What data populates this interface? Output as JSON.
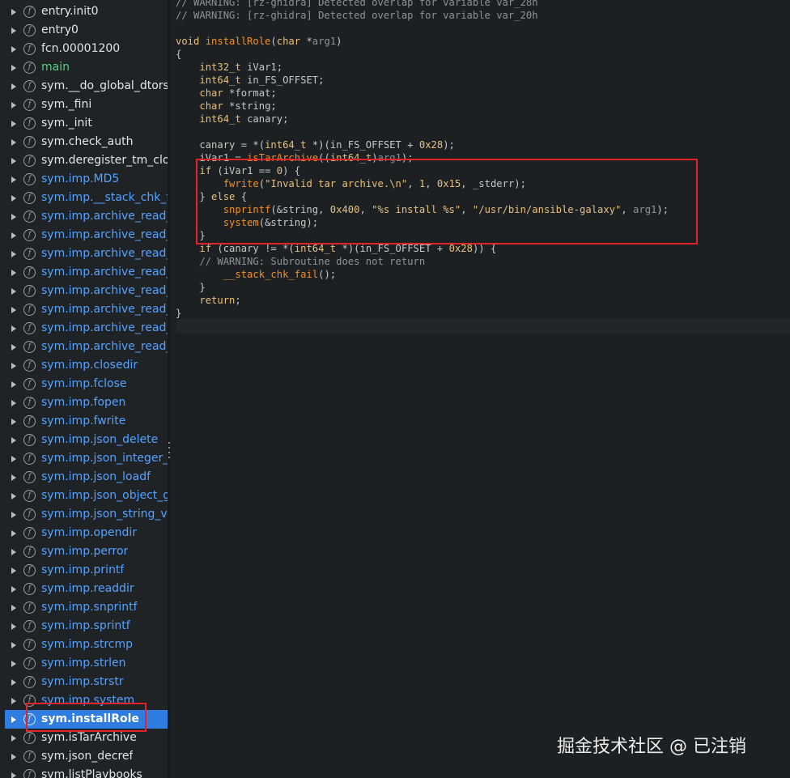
{
  "sidebar": {
    "items": [
      {
        "label": "entry.init0",
        "color": "white"
      },
      {
        "label": "entry0",
        "color": "white"
      },
      {
        "label": "fcn.00001200",
        "color": "white"
      },
      {
        "label": "main",
        "color": "green"
      },
      {
        "label": "sym.__do_global_dtors_",
        "color": "white"
      },
      {
        "label": "sym._fini",
        "color": "white"
      },
      {
        "label": "sym._init",
        "color": "white"
      },
      {
        "label": "sym.check_auth",
        "color": "white"
      },
      {
        "label": "sym.deregister_tm_clon",
        "color": "white"
      },
      {
        "label": "sym.imp.MD5",
        "color": "blue"
      },
      {
        "label": "sym.imp.__stack_chk_fa",
        "color": "blue"
      },
      {
        "label": "sym.imp.archive_read_c",
        "color": "blue"
      },
      {
        "label": "sym.imp.archive_read_c",
        "color": "blue"
      },
      {
        "label": "sym.imp.archive_read_f",
        "color": "blue"
      },
      {
        "label": "sym.imp.archive_read_n",
        "color": "blue"
      },
      {
        "label": "sym.imp.archive_read_n",
        "color": "blue"
      },
      {
        "label": "sym.imp.archive_read_o",
        "color": "blue"
      },
      {
        "label": "sym.imp.archive_read_s",
        "color": "blue"
      },
      {
        "label": "sym.imp.archive_read_s",
        "color": "blue"
      },
      {
        "label": "sym.imp.closedir",
        "color": "blue"
      },
      {
        "label": "sym.imp.fclose",
        "color": "blue"
      },
      {
        "label": "sym.imp.fopen",
        "color": "blue"
      },
      {
        "label": "sym.imp.fwrite",
        "color": "blue"
      },
      {
        "label": "sym.imp.json_delete",
        "color": "blue"
      },
      {
        "label": "sym.imp.json_integer_v",
        "color": "blue"
      },
      {
        "label": "sym.imp.json_loadf",
        "color": "blue"
      },
      {
        "label": "sym.imp.json_object_ge",
        "color": "blue"
      },
      {
        "label": "sym.imp.json_string_va",
        "color": "blue"
      },
      {
        "label": "sym.imp.opendir",
        "color": "blue"
      },
      {
        "label": "sym.imp.perror",
        "color": "blue"
      },
      {
        "label": "sym.imp.printf",
        "color": "blue"
      },
      {
        "label": "sym.imp.readdir",
        "color": "blue"
      },
      {
        "label": "sym.imp.snprintf",
        "color": "blue"
      },
      {
        "label": "sym.imp.sprintf",
        "color": "blue"
      },
      {
        "label": "sym.imp.strcmp",
        "color": "blue"
      },
      {
        "label": "sym.imp.strlen",
        "color": "blue"
      },
      {
        "label": "sym.imp.strstr",
        "color": "blue"
      },
      {
        "label": "sym.imp.system",
        "color": "blue"
      },
      {
        "label": "sym.installRole",
        "color": "selected"
      },
      {
        "label": "sym.isTarArchive",
        "color": "white"
      },
      {
        "label": "sym.json_decref",
        "color": "white"
      },
      {
        "label": "sym.listPlaybooks",
        "color": "white"
      }
    ]
  },
  "code": {
    "lines": [
      [
        [
          "cm",
          "// WARNING: [rz-ghidra] Detected overlap for variable var_28h"
        ]
      ],
      [
        [
          "cm",
          "// WARNING: [rz-ghidra] Detected overlap for variable var_20h"
        ]
      ],
      [],
      [
        [
          "kw",
          "void "
        ],
        [
          "fn",
          "installRole"
        ],
        [
          "tx",
          "("
        ],
        [
          "ty",
          "char"
        ],
        [
          "tx",
          " *"
        ],
        [
          "ar",
          "arg1"
        ],
        [
          "tx",
          ")"
        ]
      ],
      [
        [
          "tx",
          "{"
        ]
      ],
      [
        [
          "tx",
          "    "
        ],
        [
          "ty",
          "int32_t"
        ],
        [
          "tx",
          " iVar1;"
        ]
      ],
      [
        [
          "tx",
          "    "
        ],
        [
          "ty",
          "int64_t"
        ],
        [
          "tx",
          " in_FS_OFFSET;"
        ]
      ],
      [
        [
          "tx",
          "    "
        ],
        [
          "ty",
          "char"
        ],
        [
          "tx",
          " *format;"
        ]
      ],
      [
        [
          "tx",
          "    "
        ],
        [
          "ty",
          "char"
        ],
        [
          "tx",
          " *string;"
        ]
      ],
      [
        [
          "tx",
          "    "
        ],
        [
          "ty",
          "int64_t"
        ],
        [
          "tx",
          " canary;"
        ]
      ],
      [],
      [
        [
          "tx",
          "    canary = *("
        ],
        [
          "ty",
          "int64_t"
        ],
        [
          "tx",
          " *)(in_FS_OFFSET + "
        ],
        [
          "nu",
          "0x28"
        ],
        [
          "tx",
          ");"
        ]
      ],
      [
        [
          "tx",
          "    iVar1 = "
        ],
        [
          "fn",
          "isTarArchive"
        ],
        [
          "tx",
          "(("
        ],
        [
          "ty",
          "int64_t"
        ],
        [
          "tx",
          ")"
        ],
        [
          "ar",
          "arg1"
        ],
        [
          "tx",
          ");"
        ]
      ],
      [
        [
          "tx",
          "    "
        ],
        [
          "kw",
          "if"
        ],
        [
          "tx",
          " (iVar1 == "
        ],
        [
          "nu",
          "0"
        ],
        [
          "tx",
          ") {"
        ]
      ],
      [
        [
          "tx",
          "        "
        ],
        [
          "fn",
          "fwrite"
        ],
        [
          "tx",
          "("
        ],
        [
          "st",
          "\"Invalid tar archive.\\n\""
        ],
        [
          "tx",
          ", "
        ],
        [
          "nu",
          "1"
        ],
        [
          "tx",
          ", "
        ],
        [
          "nu",
          "0x15"
        ],
        [
          "tx",
          ", _stderr);"
        ]
      ],
      [
        [
          "tx",
          "    } "
        ],
        [
          "kw",
          "else"
        ],
        [
          "tx",
          " {"
        ]
      ],
      [
        [
          "tx",
          "        "
        ],
        [
          "fn",
          "snprintf"
        ],
        [
          "tx",
          "(&string, "
        ],
        [
          "nu",
          "0x400"
        ],
        [
          "tx",
          ", "
        ],
        [
          "st",
          "\"%s install %s\""
        ],
        [
          "tx",
          ", "
        ],
        [
          "st",
          "\"/usr/bin/ansible-galaxy\""
        ],
        [
          "tx",
          ", "
        ],
        [
          "ar",
          "arg1"
        ],
        [
          "tx",
          ");"
        ]
      ],
      [
        [
          "tx",
          "        "
        ],
        [
          "fn",
          "system"
        ],
        [
          "tx",
          "(&string);"
        ]
      ],
      [
        [
          "tx",
          "    }"
        ]
      ],
      [
        [
          "tx",
          "    "
        ],
        [
          "kw",
          "if"
        ],
        [
          "tx",
          " (canary != *("
        ],
        [
          "ty",
          "int64_t"
        ],
        [
          "tx",
          " *)(in_FS_OFFSET + "
        ],
        [
          "nu",
          "0x28"
        ],
        [
          "tx",
          ")) {"
        ]
      ],
      [
        [
          "tx",
          "    "
        ],
        [
          "cm",
          "// WARNING: Subroutine does not return"
        ]
      ],
      [
        [
          "tx",
          "        "
        ],
        [
          "fn",
          "__stack_chk_fail"
        ],
        [
          "tx",
          "();"
        ]
      ],
      [
        [
          "tx",
          "    }"
        ]
      ],
      [
        [
          "tx",
          "    "
        ],
        [
          "kw",
          "return"
        ],
        [
          "tx",
          ";"
        ]
      ],
      [
        [
          "tx",
          "}"
        ]
      ]
    ]
  },
  "colors": {
    "sidebar_bg": "#202326",
    "code_bg": "#1d2023",
    "selected_bg": "#2f7de0",
    "highlight_box": "#e0252a"
  },
  "watermark": "掘金技术社区 @ 已注销"
}
